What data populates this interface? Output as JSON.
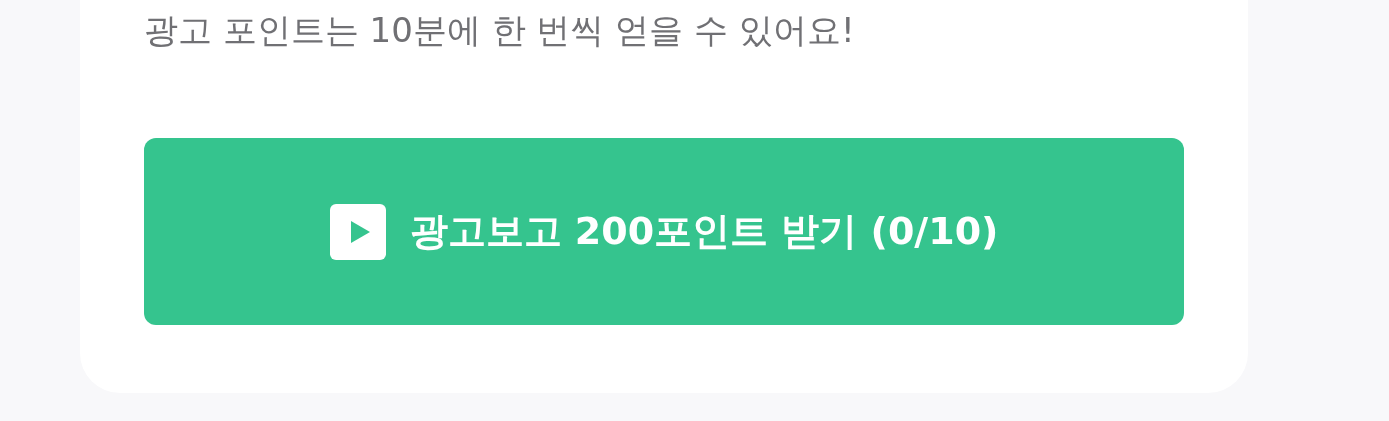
{
  "notice": "광고 포인트는 10분에 한 번씩 얻을 수 있어요!",
  "button": {
    "label": "광고보고 200포인트 받기 (0/10)",
    "disabled": false
  }
}
